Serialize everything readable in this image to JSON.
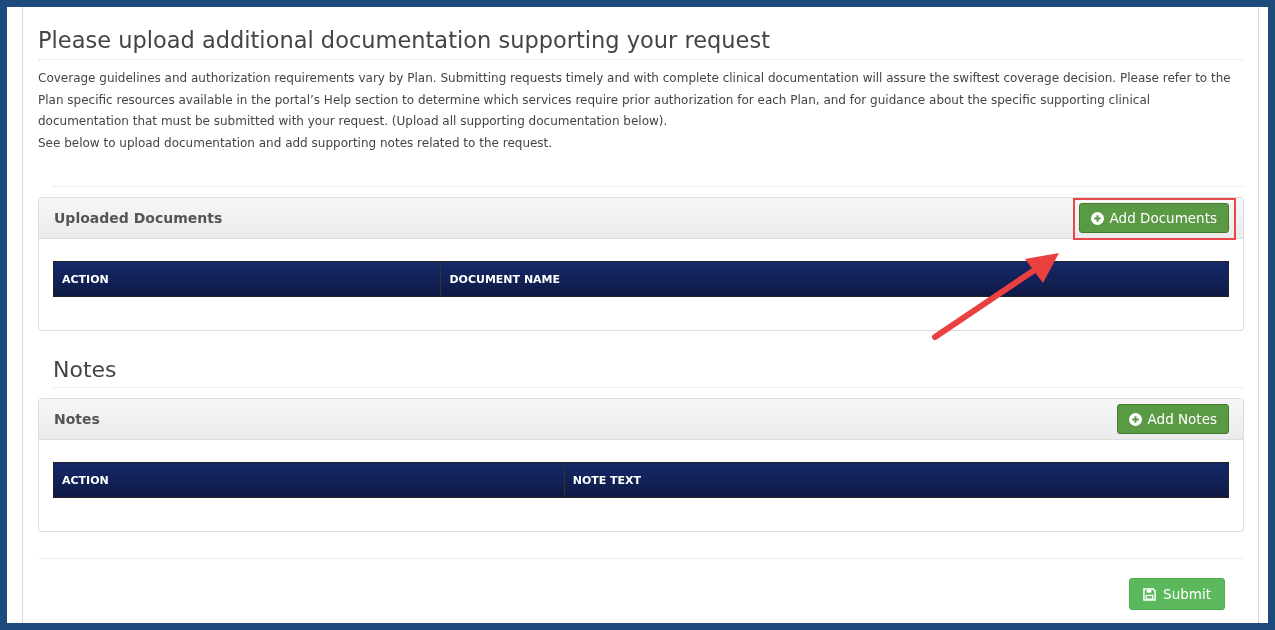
{
  "page_title": "Please upload additional documentation supporting your request",
  "intro": [
    "Coverage guidelines and authorization requirements vary by Plan. Submitting requests timely and with complete clinical documentation will assure the swiftest coverage decision. Please refer to the Plan specific resources available in the portal’s Help section to determine which services require prior authorization for each Plan, and for guidance about the specific supporting clinical documentation that must be submitted with your request. (Upload all supporting documentation below).",
    "See below to upload documentation and add supporting notes related to the request."
  ],
  "panels": [
    {
      "title": "Uploaded Documents",
      "button": "Add Documents",
      "columns": [
        "ACTION",
        "DOCUMENT NAME"
      ]
    },
    {
      "section_heading": "Notes",
      "title": "Notes",
      "button": "Add Notes",
      "columns": [
        "ACTION",
        "NOTE TEXT"
      ]
    }
  ],
  "submit_button": "Submit"
}
